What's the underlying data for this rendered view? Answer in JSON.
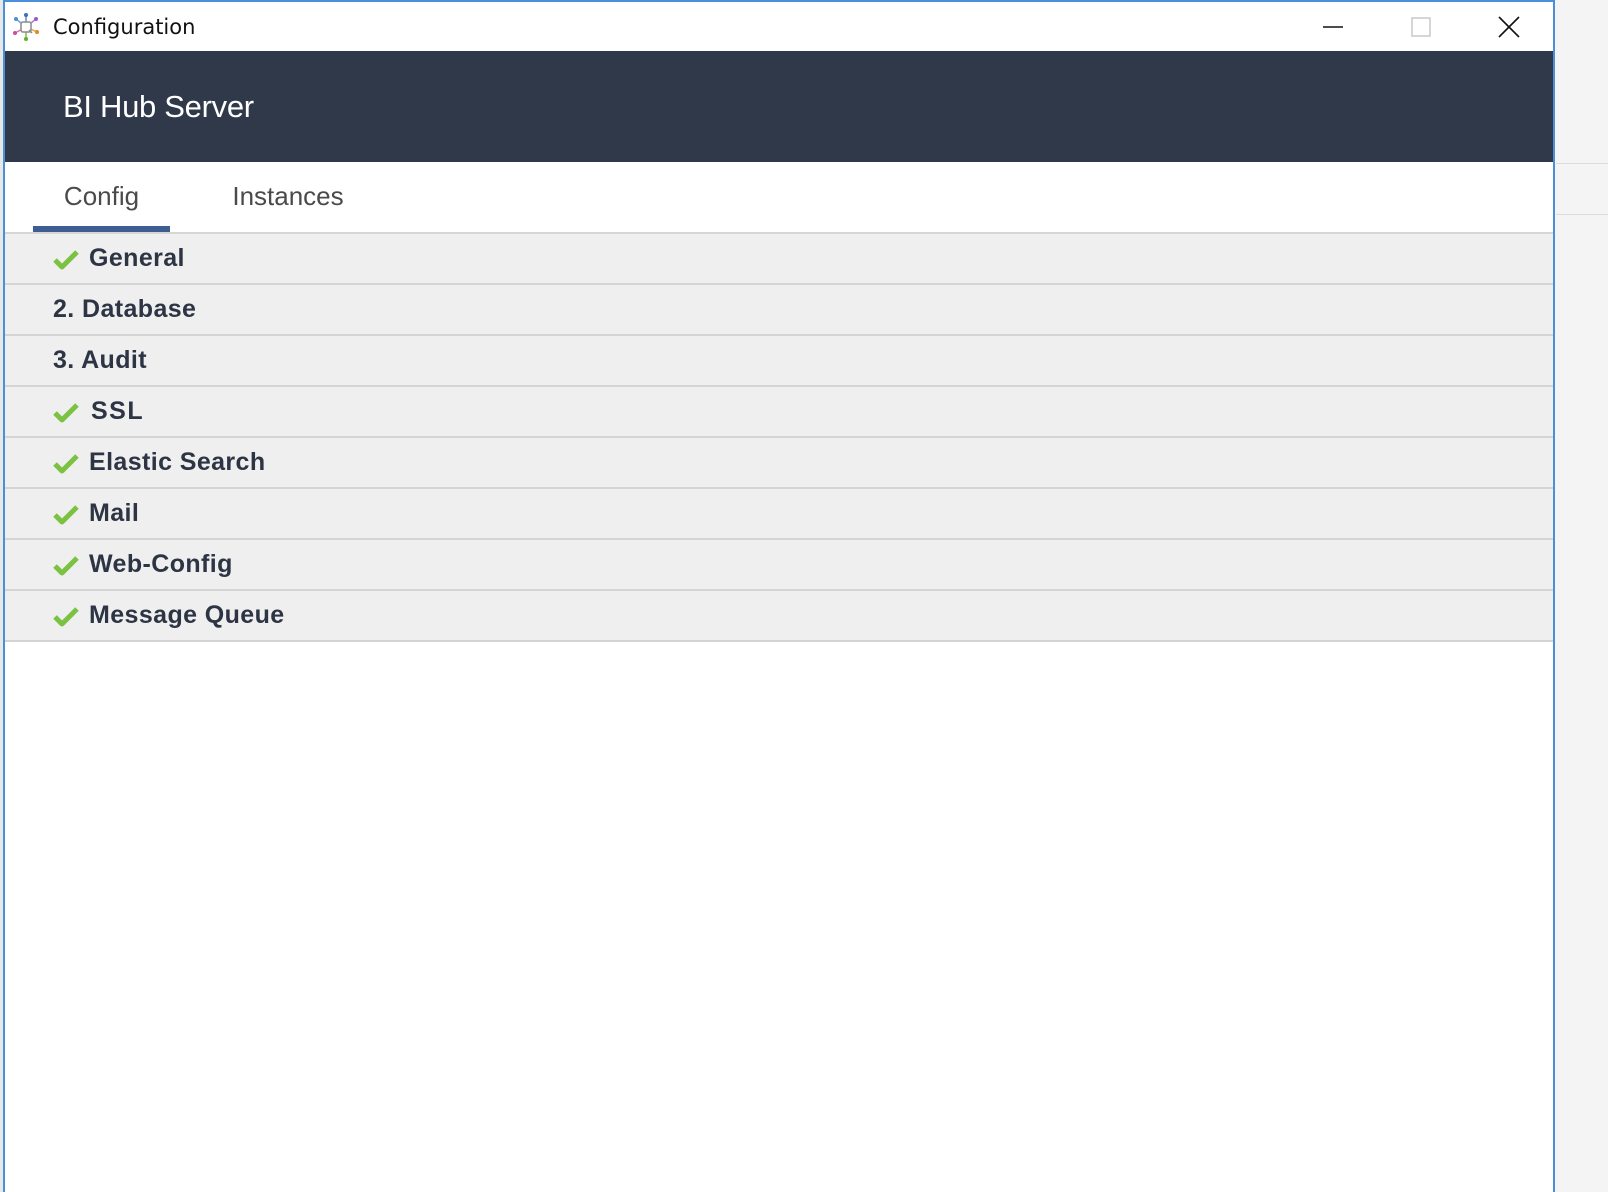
{
  "window": {
    "title": "Configuration",
    "icon": "app-config-hub-icon",
    "controls": {
      "minimize": "minimize-icon",
      "maximize": "maximize-icon",
      "close": "close-icon"
    }
  },
  "header": {
    "title": "BI Hub Server",
    "background_color": "#30394a"
  },
  "tabs": [
    {
      "label": "Config",
      "active": true
    },
    {
      "label": "Instances",
      "active": false
    }
  ],
  "accent_color": "#3e5e93",
  "check_color": "#7cc242",
  "config_items": [
    {
      "label": "General",
      "completed": true
    },
    {
      "label": "2. Database",
      "completed": false
    },
    {
      "label": "3. Audit",
      "completed": false
    },
    {
      "label": "SSL",
      "completed": true
    },
    {
      "label": "Elastic Search",
      "completed": true
    },
    {
      "label": "Mail",
      "completed": true
    },
    {
      "label": "Web-Config",
      "completed": true
    },
    {
      "label": "Message Queue",
      "completed": true
    }
  ]
}
